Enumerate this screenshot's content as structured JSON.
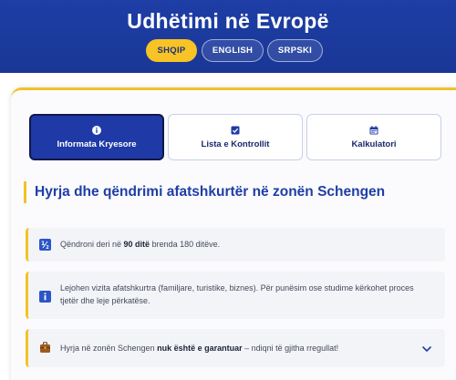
{
  "header": {
    "title": "Udhëtimi në Evropë",
    "languages": [
      {
        "label": "SHQIP",
        "active": true
      },
      {
        "label": "ENGLISH",
        "active": false
      },
      {
        "label": "SRPSKI",
        "active": false
      }
    ]
  },
  "tabs": [
    {
      "label": "Informata Kryesore",
      "icon": "info-icon",
      "active": true
    },
    {
      "label": "Lista e Kontrollit",
      "icon": "checkbox-icon",
      "active": false
    },
    {
      "label": "Kalkulatori",
      "icon": "calendar-icon",
      "active": false
    }
  ],
  "section": {
    "title": "Hyrja dhe qëndrimi afatshkurtër në zonën Schengen"
  },
  "info_items": [
    {
      "icon": "ratio-icon",
      "text_before": "Qëndroni deri në ",
      "text_bold": "90 ditë",
      "text_after": " brenda 180 ditëve."
    },
    {
      "icon": "info-icon",
      "text": "Lejohen vizita afatshkurtra (familjare, turistike, biznes). Për punësim ose studime kërkohet proces tjetër dhe leje përkatëse."
    },
    {
      "icon": "luggage-icon",
      "text_before": "Hyrja në zonën Schengen ",
      "text_bold": "nuk është e garantuar",
      "text_after": " – ndiqni të gjitha rregullat!",
      "expand_icon": "chevron-down-icon"
    }
  ],
  "colors": {
    "primary": "#1e3ea6",
    "accent": "#f2c328"
  }
}
